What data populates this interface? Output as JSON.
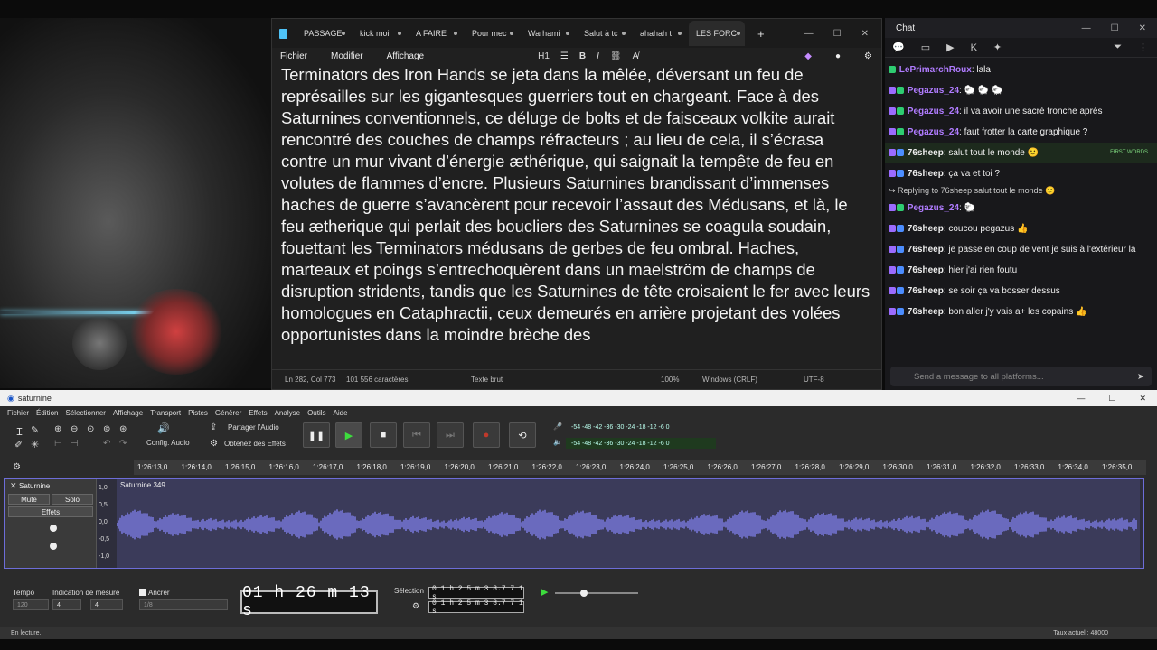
{
  "notepad": {
    "tabs": [
      "PASSAGE",
      "kick moi",
      "A FAIRE",
      "Pour mec",
      "Warhami",
      "Salut à tc",
      "ahahah t",
      "LES FORC"
    ],
    "menu": [
      "Fichier",
      "Modifier",
      "Affichage"
    ],
    "heading": "H1",
    "text": "Terminators des Iron Hands se jeta dans la mêlée, déversant un feu de représailles sur les gigantesques guerriers tout en chargeant. Face à des Saturnines conventionnels, ce déluge de bolts et de faisceaux volkite aurait rencontré des couches de champs réfracteurs ; au lieu de cela, il s’écrasa contre un mur vivant d’énergie æthérique, qui saignait la tempête de feu en volutes de flammes d’encre. Plusieurs Saturnines brandissant d’immenses haches de guerre s’avancèrent pour recevoir l’assaut des Médusans, et là, le feu ætherique qui perlait des boucliers des Saturnines se coagula soudain, fouettant les Terminators médusans de gerbes de feu ombral. Haches, marteaux et poings s’entrechoquèrent dans un maelström de champs de disruption stridents, tandis que les Saturnines de tête croisaient le fer avec leurs homologues en Cataphractii, ceux demeurés en arrière projetant des volées opportunistes dans la moindre brèche des",
    "status": {
      "position": "Ln 282, Col 773",
      "chars": "101 556 caractères",
      "format": "Texte brut",
      "zoom": "100%",
      "eol": "Windows (CRLF)",
      "encoding": "UTF-8"
    }
  },
  "chat": {
    "title": "Chat",
    "messages": [
      {
        "user": "LePrimarchRoux",
        "color": "#b07cff",
        "text": "lala"
      },
      {
        "user": "Pegazus_24",
        "color": "#b07cff",
        "text": "🐑 🐑 🐑"
      },
      {
        "user": "Pegazus_24",
        "color": "#b07cff",
        "text": "il va avoir une sacré tronche après"
      },
      {
        "user": "Pegazus_24",
        "color": "#b07cff",
        "text": "faut frotter la carte graphique ?"
      },
      {
        "user": "76sheep",
        "color": "#ffffff",
        "text": "salut tout le monde 🙂"
      },
      {
        "user": "76sheep",
        "color": "#ffffff",
        "text": "ça va et toi ?"
      },
      {
        "user": "Pegazus_24",
        "color": "#b07cff",
        "text": "🐑"
      },
      {
        "user": "76sheep",
        "color": "#ffffff",
        "text": "coucou pegazus 👍"
      },
      {
        "user": "76sheep",
        "color": "#ffffff",
        "text": "je passe en coup de vent je suis à l'extérieur la"
      },
      {
        "user": "76sheep",
        "color": "#ffffff",
        "text": "hier j'ai rien foutu"
      },
      {
        "user": "76sheep",
        "color": "#ffffff",
        "text": "se soir ça va bosser dessus"
      },
      {
        "user": "76sheep",
        "color": "#ffffff",
        "text": "bon aller j'y vais a+ les copains 👍"
      }
    ],
    "first_words": "FIRST WORDS",
    "reply": "Replying to 76sheep salut tout le monde 🙂",
    "input_placeholder": "Send a message to all platforms..."
  },
  "audacity": {
    "title": "saturnine",
    "menu": [
      "Fichier",
      "Édition",
      "Sélectionner",
      "Affichage",
      "Transport",
      "Pistes",
      "Générer",
      "Effets",
      "Analyse",
      "Outils",
      "Aide"
    ],
    "config_audio": "Config. Audio",
    "share": "Partager l'Audio",
    "get_effects": "Obtenez des Effets",
    "meter_scale": "-54 -48 -42 -36 -30 -24 -18 -12 -6 0",
    "ruler": [
      "1:26:13,0",
      "1:26:14,0",
      "1:26:15,0",
      "1:26:16,0",
      "1:26:17,0",
      "1:26:18,0",
      "1:26:19,0",
      "1:26:20,0",
      "1:26:21,0",
      "1:26:22,0",
      "1:26:23,0",
      "1:26:24,0",
      "1:26:25,0",
      "1:26:26,0",
      "1:26:27,0",
      "1:26:28,0",
      "1:26:29,0",
      "1:26:30,0",
      "1:26:31,0",
      "1:26:32,0",
      "1:26:33,0",
      "1:26:34,0",
      "1:26:35,0"
    ],
    "track": {
      "name": "Saturnine",
      "mute": "Mute",
      "solo": "Solo",
      "effects": "Effets",
      "clip": "Saturnine.349",
      "scale": [
        "1,0",
        "0,5",
        "0,0",
        "-0,5",
        "-1,0"
      ]
    },
    "bottom": {
      "tempo_label": "Tempo",
      "tempo": "120",
      "time_sig_label": "Indication de mesure",
      "ts_num": "4",
      "ts_den": "4",
      "snap": "Ancrer",
      "snap_val": "1/8",
      "time": "01 h 26 m 13 s",
      "selection_label": "Sélection",
      "sel_start": "0 1 h 2 5 m 3 8.7 7 1 s",
      "sel_end": "0 1 h 2 5 m 3 8.7 7 1 s"
    },
    "status_left": "En lecture.",
    "status_right": "Taux actuel : 48000"
  }
}
